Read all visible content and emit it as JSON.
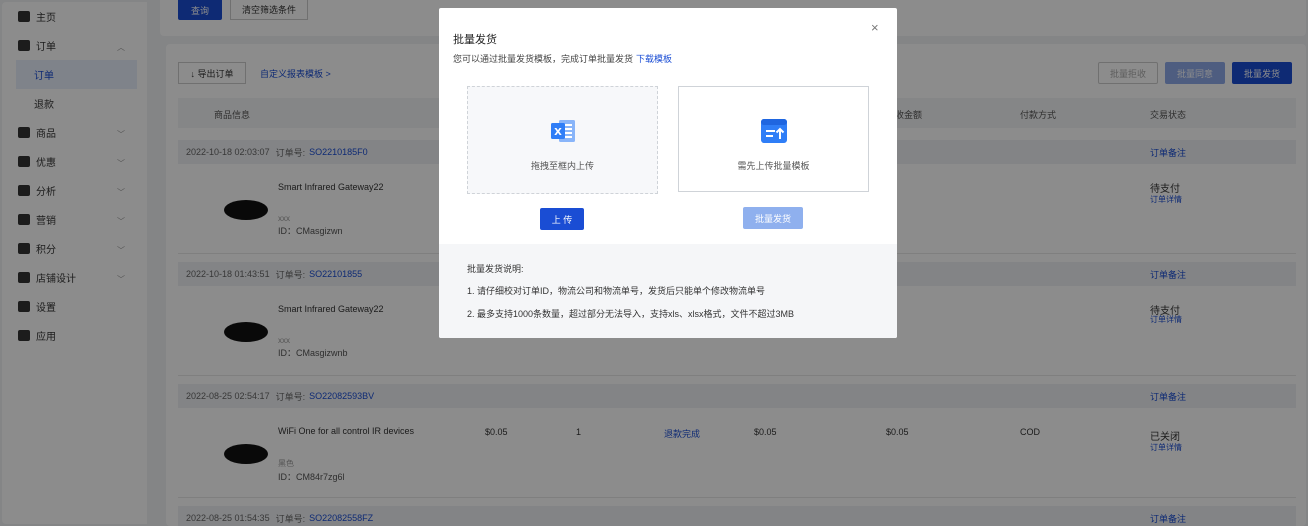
{
  "sidebar": {
    "items": [
      {
        "label": "主页",
        "icon": "monitor-icon"
      },
      {
        "label": "订单",
        "icon": "order-icon",
        "expanded": true,
        "children": [
          {
            "label": "订单",
            "active": true
          },
          {
            "label": "退款"
          }
        ]
      },
      {
        "label": "商品",
        "icon": "bag-icon"
      },
      {
        "label": "优惠",
        "icon": "coupon-icon"
      },
      {
        "label": "分析",
        "icon": "pie-chart-icon"
      },
      {
        "label": "营销",
        "icon": "megaphone-icon"
      },
      {
        "label": "积分",
        "icon": "coins-icon"
      },
      {
        "label": "店铺设计",
        "icon": "store-icon"
      },
      {
        "label": "设置",
        "icon": "gear-icon"
      },
      {
        "label": "应用",
        "icon": "apps-icon"
      }
    ]
  },
  "filter": {
    "query_label": "查询",
    "clear_label": "清空筛选条件"
  },
  "toolbar": {
    "export_label": "↓ 导出订单",
    "custom_label": "自定义报表模板 >",
    "btn1": "批量拒收",
    "btn2": "批量同意",
    "btn3": "批量发货"
  },
  "table": {
    "headers": {
      "product": "商品信息",
      "amount": "实收金额",
      "payment": "付款方式",
      "status": "交易状态"
    }
  },
  "orders": [
    {
      "time": "2022-10-18 02:03:07",
      "no_label": "订单号:",
      "no": "SO2210185F0",
      "remark": "订单备注",
      "name": "Smart Infrared Gateway22",
      "spec": "xxx",
      "id": "ID：CMasgizwn",
      "status": "待支付",
      "detail": "订单详情"
    },
    {
      "time": "2022-10-18 01:43:51",
      "no_label": "订单号:",
      "no": "SO22101855",
      "remark": "订单备注",
      "name": "Smart Infrared Gateway22",
      "spec": "xxx",
      "id": "ID：CMasgizwnb",
      "status": "待支付",
      "detail": "订单详情"
    },
    {
      "time": "2022-08-25 02:54:17",
      "no_label": "订单号:",
      "no": "SO22082593BV",
      "remark": "订单备注",
      "name": "WiFi One for all control IR devices",
      "spec": "黑色",
      "id": "ID：CM84r7zg6l",
      "price": "$0.05",
      "qty": "1",
      "refund": "退款完成",
      "subtotal": "$0.05",
      "amount": "$0.05",
      "payment": "COD",
      "status": "已关闭",
      "detail": "订单详情"
    },
    {
      "time": "2022-08-25 01:54:35",
      "no_label": "订单号:",
      "no": "SO22082558FZ",
      "remark": "订单备注"
    }
  ],
  "modal": {
    "title": "批量发货",
    "desc": "您可以通过批量发货模板，完成订单批量发货",
    "download_link": "下载模板",
    "close_glyph": "×",
    "dropzone_label": "拖拽至框内上传",
    "upload_first_label": "需先上传批量模板",
    "upload_button": "上 传",
    "batch_button": "批量发货",
    "notes_title": "批量发货说明:",
    "notes": [
      "1. 请仔细校对订单ID，物流公司和物流单号，发货后只能单个修改物流单号",
      "2. 最多支持1000条数量，超过部分无法导入，支持xls、xlsx格式，文件不超过3MB"
    ]
  },
  "colors": {
    "accent": "#1a4dd4",
    "excel": "#2f7ef7",
    "overlay": "rgba(0,0,0,0.45)"
  }
}
